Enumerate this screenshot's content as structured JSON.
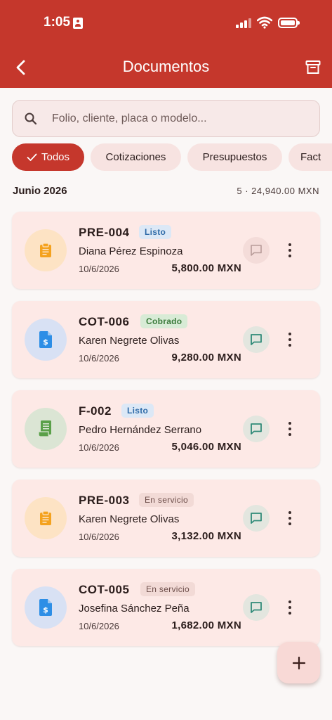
{
  "status_bar": {
    "time": "1:05"
  },
  "app_bar": {
    "title": "Documentos"
  },
  "search": {
    "placeholder": "Folio, cliente, placa o modelo..."
  },
  "filters": [
    {
      "label": "Todos",
      "active": true
    },
    {
      "label": "Cotizaciones",
      "active": false
    },
    {
      "label": "Presupuestos",
      "active": false
    },
    {
      "label": "Fact",
      "active": false
    }
  ],
  "group": {
    "month": "Junio 2026",
    "summary": "5 · 24,940.00 MXN"
  },
  "documents": [
    {
      "folio": "PRE-004",
      "status": "Listo",
      "client": "Diana Pérez Espinoza",
      "date": "10/6/2026",
      "amount": "5,800.00 MXN",
      "icon": "clipboard-icon",
      "icon_color": "#f4a21e",
      "avatar_bg": "#fde3c4",
      "message_active": false
    },
    {
      "folio": "COT-006",
      "status": "Cobrado",
      "client": "Karen Negrete Olivas",
      "date": "10/6/2026",
      "amount": "9,280.00 MXN",
      "icon": "invoice-dollar-icon",
      "icon_color": "#2d8ee6",
      "avatar_bg": "#d8e1f4",
      "message_active": true
    },
    {
      "folio": "F-002",
      "status": "Listo",
      "client": "Pedro Hernández Serrano",
      "date": "10/6/2026",
      "amount": "5,046.00 MXN",
      "icon": "receipt-icon",
      "icon_color": "#5aa049",
      "avatar_bg": "#dbe5d4",
      "message_active": true
    },
    {
      "folio": "PRE-003",
      "status": "En servicio",
      "client": "Karen Negrete Olivas",
      "date": "10/6/2026",
      "amount": "3,132.00 MXN",
      "icon": "clipboard-icon",
      "icon_color": "#f4a21e",
      "avatar_bg": "#fde3c4",
      "message_active": true
    },
    {
      "folio": "COT-005",
      "status": "En servicio",
      "client": "Josefina Sánchez Peña",
      "date": "10/6/2026",
      "amount": "1,682.00 MXN",
      "icon": "invoice-dollar-icon",
      "icon_color": "#2d8ee6",
      "avatar_bg": "#d8e1f4",
      "message_active": true
    }
  ],
  "colors": {
    "primary": "#c5372c",
    "card_bg": "#fde9e6",
    "chip_bg": "#f7e3e1",
    "message_active": "#2f8a78",
    "message_inactive": "#b89c99"
  }
}
